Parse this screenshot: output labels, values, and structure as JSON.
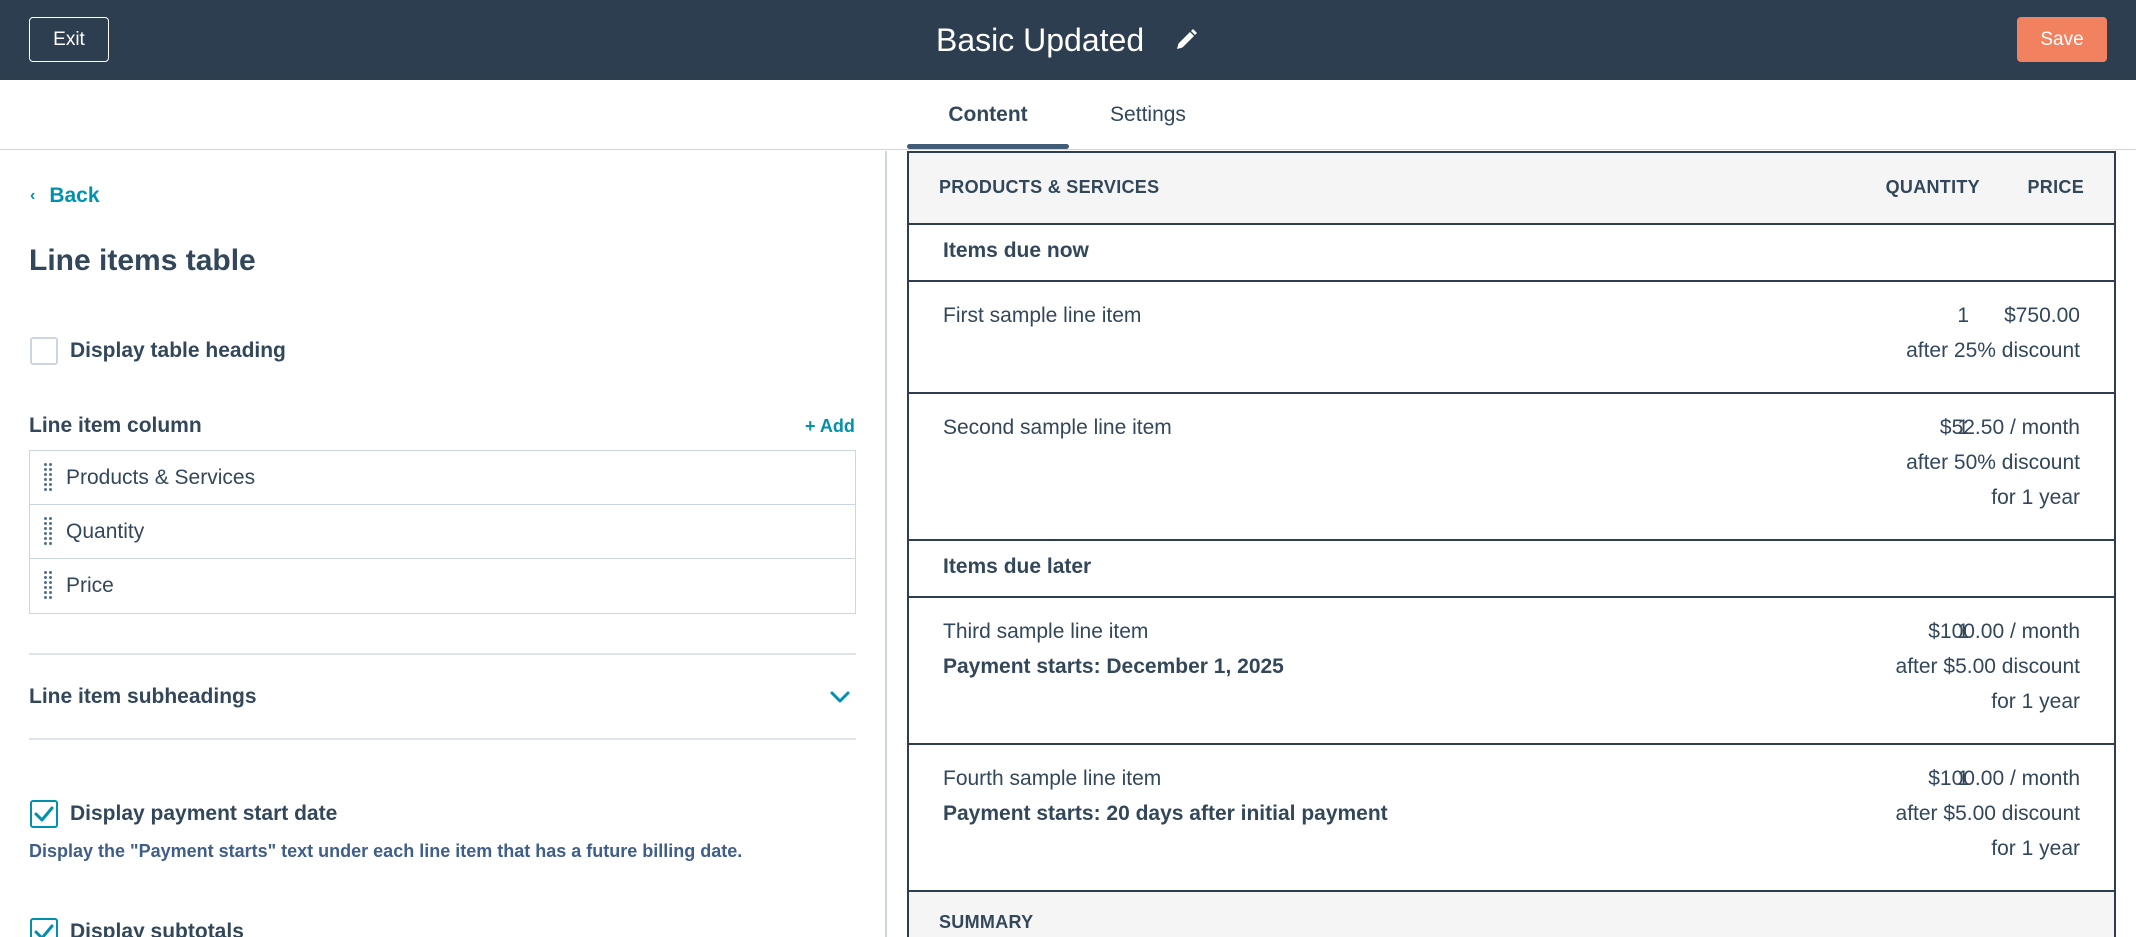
{
  "topbar": {
    "exit_label": "Exit",
    "title": "Basic Updated",
    "save_label": "Save"
  },
  "tabs": [
    {
      "label": "Content",
      "active": true
    },
    {
      "label": "Settings",
      "active": false
    }
  ],
  "left_panel": {
    "back_label": "Back",
    "title": "Line items table",
    "display_heading": {
      "label": "Display table heading",
      "checked": false
    },
    "line_item_column": {
      "label": "Line item column",
      "add_label": "+ Add",
      "items": [
        "Products & Services",
        "Quantity",
        "Price"
      ]
    },
    "subheadings_label": "Line item subheadings",
    "payment_start": {
      "label": "Display payment start date",
      "checked": true,
      "help": "Display the \"Payment starts\" text under each line item that has a future billing date."
    },
    "subtotals": {
      "label": "Display subtotals",
      "checked": true
    }
  },
  "preview": {
    "headers": {
      "product": "PRODUCTS & SERVICES",
      "quantity": "QUANTITY",
      "price": "PRICE"
    },
    "groups": [
      {
        "title": "Items due now",
        "rows": [
          {
            "name": "First sample line item",
            "payment": "",
            "qty": "1",
            "price": [
              "$750.00",
              "after 25% discount"
            ]
          },
          {
            "name": "Second sample line item",
            "payment": "",
            "qty": "1",
            "price": [
              "$52.50 / month",
              "after 50% discount",
              "for 1 year"
            ]
          }
        ]
      },
      {
        "title": "Items due later",
        "rows": [
          {
            "name": "Third sample line item",
            "payment": "Payment starts: December 1, 2025",
            "qty": "1",
            "price": [
              "$100.00 / month",
              "after $5.00 discount",
              "for 1 year"
            ]
          },
          {
            "name": "Fourth sample line item",
            "payment": "Payment starts: 20 days after initial payment",
            "qty": "1",
            "price": [
              "$100.00 / month",
              "after $5.00 discount",
              "for 1 year"
            ]
          }
        ]
      }
    ],
    "summary_label": "SUMMARY"
  },
  "colors": {
    "topbar": "#2d3e50",
    "accent": "#0091ae",
    "save": "#f2825f",
    "text": "#33475b"
  }
}
